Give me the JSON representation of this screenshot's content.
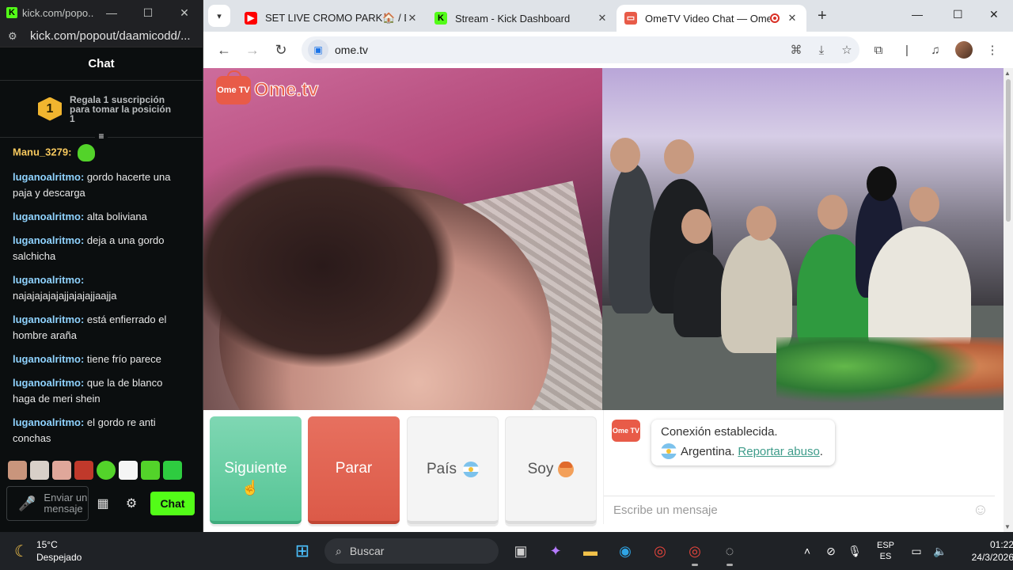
{
  "kick_window": {
    "title": "kick.com/popo...",
    "url": "kick.com/popout/daamicodd/...",
    "chat_header": "Chat",
    "pinned": {
      "badge": "1",
      "text": "Regala 1 suscripción para tomar la posición 1"
    },
    "messages": [
      {
        "user": "Manu_3279:",
        "text": ""
      },
      {
        "user": "luganoalritmo:",
        "text": "gordo hacerte una paja y descarga"
      },
      {
        "user": "luganoalritmo:",
        "text": "alta boliviana"
      },
      {
        "user": "luganoalritmo:",
        "text": "deja a una gordo salchicha"
      },
      {
        "user": "luganoalritmo:",
        "text": "najajajajajajjajajajjaajja"
      },
      {
        "user": "luganoalritmo:",
        "text": "está enfierrado el hombre araña"
      },
      {
        "user": "luganoalritmo:",
        "text": "tiene frío parece"
      },
      {
        "user": "luganoalritmo:",
        "text": "que la de blanco haga de meri shein"
      },
      {
        "user": "luganoalritmo:",
        "text": "el gordo re anti conchas"
      }
    ],
    "input_placeholder": "Enviar un mensaje",
    "send_label": "Chat"
  },
  "browser": {
    "tabs": [
      {
        "title": "SET LIVE CROMO PARK🏠 / DY",
        "icon": "youtube-icon",
        "color": "#ff0000"
      },
      {
        "title": "Stream - Kick Dashboard",
        "icon": "kick-icon",
        "color": "#53fc18"
      },
      {
        "title": "OmeTV Video Chat — Ome",
        "icon": "ometv-icon",
        "color": "#e85b48",
        "active": true
      }
    ],
    "url": "ome.tv"
  },
  "ometv": {
    "logo_text": "Ome.tv",
    "logo_badge": "Ome TV",
    "buttons": {
      "next": "Siguiente",
      "stop": "Parar",
      "country": "País",
      "gender": "Soy"
    },
    "system_message": {
      "line1": "Conexión establecida.",
      "country": "Argentina.",
      "report": "Reportar abuso"
    },
    "message_placeholder": "Escribe un mensaje"
  },
  "taskbar": {
    "weather": {
      "temp": "15°C",
      "condition": "Despejado"
    },
    "search_placeholder": "Buscar",
    "lang": {
      "line1": "ESP",
      "line2": "ES"
    },
    "clock": {
      "time": "01:22",
      "date": "24/3/2026"
    }
  }
}
